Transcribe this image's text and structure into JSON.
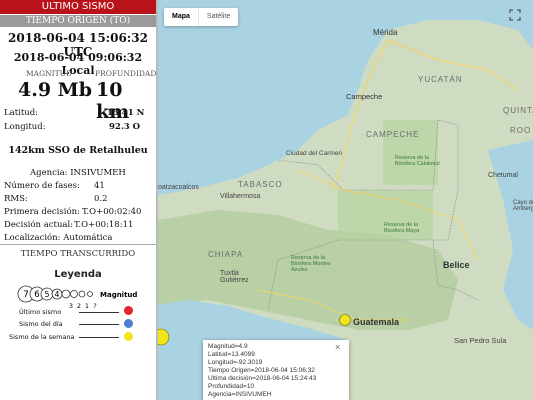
{
  "panel": {
    "header": "ULTIMO SISMO",
    "origin_header": "TIEMPO ORIGEN (TO)",
    "utc_time": "2018-06-04 15:06:32 UTC",
    "local_time": "2018-06-04 09:06:32 Local",
    "magnitude_label": "MAGNITUD",
    "depth_label": "PROFUNDIDAD",
    "magnitude": "4.9 Mb",
    "depth": "10 km",
    "lat_label": "Latitud:",
    "lat_value": "13.41 N",
    "lon_label": "Longitud:",
    "lon_value": "92.3 O",
    "location": "142km SSO de Retalhuleu",
    "agency": "Agencia: INSIVUMEH",
    "phases_label": "Número de fases:",
    "phases_value": "41",
    "rms_label": "RMS:",
    "rms_value": "0.2",
    "first_decision_label": "Primera decisión:",
    "first_decision_value": "T.O+00:02:40",
    "current_decision_label": "Decisión actual:",
    "current_decision_value": "T.O+00:18:11",
    "localization": "Localización: Automática",
    "elapsed_header": "TIEMPO TRANSCURRIDO"
  },
  "legend": {
    "title": "Leyenda",
    "magnitudes": [
      "7",
      "6",
      "5",
      "4",
      "3",
      "2",
      "1",
      "?"
    ],
    "magnitud_label": "Magnitud",
    "items": [
      {
        "label": "Último sismo",
        "color": "#e3262b"
      },
      {
        "label": "Sismo del día",
        "color": "#4d7fd0"
      },
      {
        "label": "Sismo de la semana",
        "color": "#f1e41b"
      }
    ]
  },
  "map": {
    "type_buttons": [
      "Mapa",
      "Satélite"
    ],
    "fullscreen_icon": "fullscreen-icon",
    "labels": {
      "merida": "Mérida",
      "yucatan": "YUCATÁN",
      "campeche_city": "Campeche",
      "campeche_state": "CAMPECHE",
      "quintana": "QUINTA",
      "roo": "ROO",
      "ciudad_del_carmen": "Ciudad del Carmen",
      "calakmul": "Reserva de la Biósfera Calakmul",
      "chetumal": "Chetumal",
      "coatzacoalcos": "oatzacoalcos",
      "tabasco": "TABASCO",
      "villahermosa": "Villahermosa",
      "maya": "Reserva de la Biosfera Maya",
      "belize": "Belice",
      "tuxtla": "Tuxtla Gutiérrez",
      "guatemala": "Guatemala",
      "san_pedro_sula": "San Pedro Sula",
      "cayo": "Cayo de Ambergris",
      "montes_azules": "Reserva de la Biosfera Montes Azules",
      "chiapas": "CHIAPA"
    },
    "infobox": {
      "magnitud": "Magnitud=4.9",
      "latitud": "Latitud=13.4099",
      "longitud": "Longitud=-92.3019",
      "tiempo_origen": "Tiempo Origen=2018-06-04 15:06:32",
      "ultima_decision": "Ultima decisión=2018-06-04 15:24:43",
      "profundidad": "Profundidad=10",
      "agencia": "Agencia=INSIVUMEH",
      "close": "×"
    }
  }
}
